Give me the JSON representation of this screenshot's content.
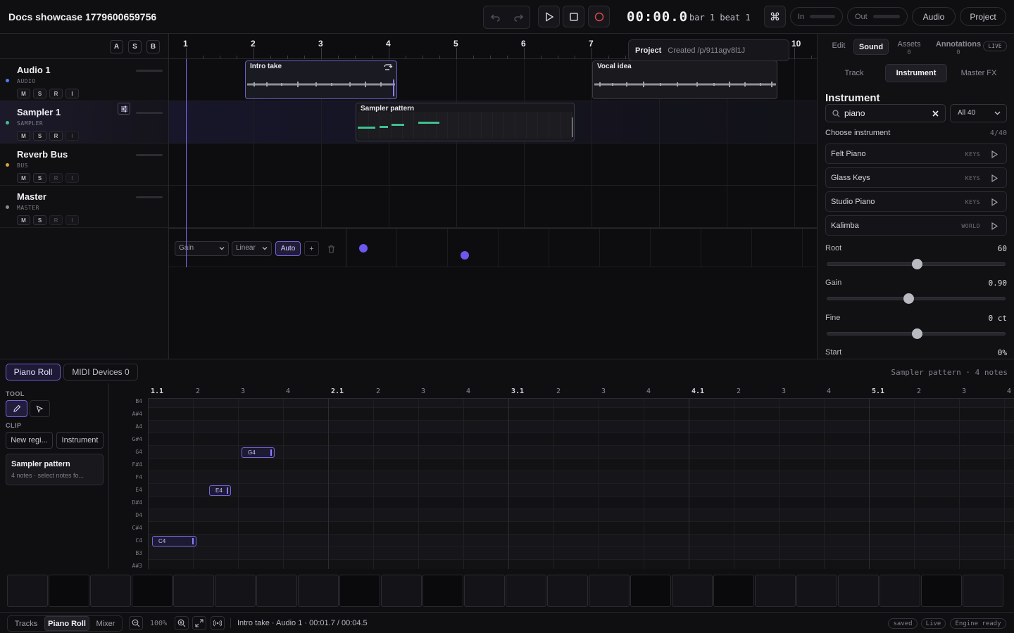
{
  "header": {
    "title": "Docs showcase 1779600659756",
    "clock": "00:00.0",
    "bar_beat": "bar 1 beat 1",
    "in_label": "In",
    "out_label": "Out",
    "audio_label": "Audio",
    "project_label": "Project",
    "shortcut_glyph": "⌘"
  },
  "tracklist": {
    "group_buttons": [
      "A",
      "S",
      "B"
    ],
    "tracks": [
      {
        "name": "Audio 1",
        "kind": "AUDIO",
        "color": "#4f7ff2",
        "buttons": [
          "M",
          "S",
          "R",
          "I"
        ]
      },
      {
        "name": "Sampler 1",
        "kind": "SAMPLER",
        "color": "#3fbf8f",
        "buttons": [
          "M",
          "S",
          "R",
          "I"
        ]
      },
      {
        "name": "Reverb Bus",
        "kind": "BUS",
        "color": "#d9a23a",
        "buttons": [
          "M",
          "S",
          "R",
          "I"
        ]
      },
      {
        "name": "Master",
        "kind": "MASTER",
        "color": "#8a8a94",
        "buttons": [
          "M",
          "S",
          "R",
          "I"
        ]
      }
    ]
  },
  "arrangement": {
    "bars": [
      "1",
      "2",
      "3",
      "4",
      "5",
      "6",
      "7",
      "10"
    ],
    "clips": [
      {
        "name": "Intro take",
        "track": 0
      },
      {
        "name": "Vocal idea",
        "track": 0
      },
      {
        "name": "Sampler pattern",
        "track": 1
      }
    ],
    "automation": {
      "param": "Gain",
      "curve": "Linear",
      "mode": "Auto",
      "add_label": "+"
    },
    "project_tip": {
      "label": "Project",
      "text": "Created /p/911agv8l1J"
    }
  },
  "inspector": {
    "tabs": [
      {
        "label": "Edit",
        "count": ""
      },
      {
        "label": "Sound",
        "count": ""
      },
      {
        "label": "Assets",
        "count": "0"
      },
      {
        "label": "Annotations",
        "count": "0"
      }
    ],
    "live_badge": "LIVE",
    "subtabs": [
      "Track",
      "Instrument",
      "Master FX"
    ],
    "instrument_title": "Instrument",
    "search_value": "piano",
    "filter_label": "All 40",
    "choose_label": "Choose instrument",
    "choose_count": "4/40",
    "instruments": [
      {
        "name": "Felt Piano",
        "category": "KEYS"
      },
      {
        "name": "Glass Keys",
        "category": "KEYS"
      },
      {
        "name": "Studio Piano",
        "category": "KEYS"
      },
      {
        "name": "Kalimba",
        "category": "WORLD"
      }
    ],
    "params": [
      {
        "label": "Root",
        "value": "60",
        "fraction": 0.5
      },
      {
        "label": "Gain",
        "value": "0.90",
        "fraction": 0.45
      },
      {
        "label": "Fine",
        "value": "0 ct",
        "fraction": 0.5
      },
      {
        "label": "Start",
        "value": "0%",
        "fraction": 0
      }
    ]
  },
  "bottom": {
    "tabs": [
      "Piano Roll",
      "MIDI Devices 0"
    ],
    "meta": "Sampler pattern · 4 notes",
    "tool_label": "TOOL",
    "clip_label": "CLIP",
    "new_region": "New regi...",
    "instrument_btn": "Instrument",
    "clip_card_title": "Sampler pattern",
    "clip_card_sub": "4 notes · select notes fo...",
    "ruler": [
      "1.1",
      "2",
      "3",
      "4",
      "2.1",
      "2",
      "3",
      "4",
      "3.1",
      "2",
      "3",
      "4",
      "4.1",
      "2",
      "3",
      "4",
      "5.1",
      "2",
      "3",
      "4"
    ],
    "keys": [
      "B4",
      "A#4",
      "A4",
      "G#4",
      "G4",
      "F#4",
      "F4",
      "E4",
      "D#4",
      "D4",
      "C#4",
      "C4",
      "B3",
      "A#3"
    ],
    "notes": [
      {
        "label": "G4"
      },
      {
        "label": "E4"
      },
      {
        "label": "C4"
      }
    ]
  },
  "statusbar": {
    "view_tabs": [
      "Tracks",
      "Piano Roll",
      "Mixer"
    ],
    "zoom": "100%",
    "info": "Intro take · Audio 1 · 00:01.7 / 00:04.5",
    "badges": [
      "saved",
      "Live",
      "Engine ready"
    ]
  }
}
